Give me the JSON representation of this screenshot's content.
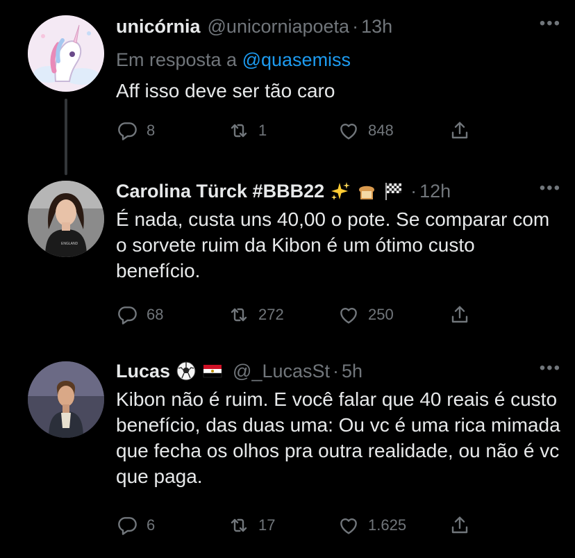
{
  "tweets": [
    {
      "name": "unicórnia",
      "handle": "@unicorniapoeta",
      "time": "13h",
      "reply_prefix": "Em resposta a",
      "reply_mention": "@quasemiss",
      "text": "Aff isso deve ser tão caro",
      "replies": "8",
      "retweets": "1",
      "likes": "848"
    },
    {
      "name": "Carolina Türck #BBB22",
      "name_emojis": [
        "sparkles-emoji",
        "bread-emoji",
        "checkered-flag-emoji"
      ],
      "handle": "",
      "time": "12h",
      "text": "É nada, custa uns 40,00 o pote. Se comparar com o sorvete ruim da Kibon é um ótimo custo benefício.",
      "replies": "68",
      "retweets": "272",
      "likes": "250"
    },
    {
      "name": "Lucas",
      "name_emojis": [
        "soccer-ball-emoji",
        "egypt-flag-emoji"
      ],
      "handle": "@_LucasSt",
      "time": "5h",
      "text": "Kibon não é ruim. E você falar que 40 reais é custo benefício, das duas uma: Ou vc é uma rica mimada que fecha os olhos pra outra realidade, ou não é vc que paga.",
      "replies": "6",
      "retweets": "17",
      "likes": "1.625"
    }
  ],
  "more_label": "•••",
  "dot": "·",
  "colors": {
    "background": "#000000",
    "text": "#e7e9ea",
    "muted": "#71767b",
    "link": "#1d9bf0"
  }
}
